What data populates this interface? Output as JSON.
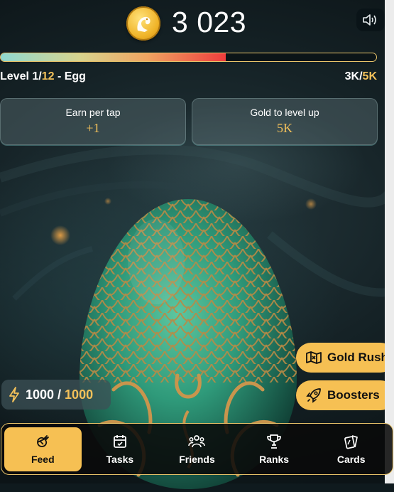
{
  "header": {
    "balance": "3 023",
    "coin_icon": "dragon-coin-icon",
    "sound_icon": "speaker-icon"
  },
  "progress": {
    "fraction": 0.6
  },
  "level": {
    "prefix": "Level 1/",
    "max": "12",
    "suffix": " - Egg",
    "current_gold": "3K/",
    "target_gold": "5K"
  },
  "stats": [
    {
      "label": "Earn per tap",
      "value": "+1"
    },
    {
      "label": "Gold to level up",
      "value": "5K"
    }
  ],
  "energy": {
    "current": "1000 / ",
    "max": "1000",
    "icon": "bolt-icon"
  },
  "actions": [
    {
      "label": "Gold Rush",
      "icon": "map-icon"
    },
    {
      "label": "Boosters",
      "icon": "rocket-icon"
    }
  ],
  "nav": [
    {
      "label": "Feed",
      "icon": "feed-icon",
      "active": true
    },
    {
      "label": "Tasks",
      "icon": "calendar-icon",
      "active": false
    },
    {
      "label": "Friends",
      "icon": "users-icon",
      "active": false
    },
    {
      "label": "Ranks",
      "icon": "trophy-icon",
      "active": false
    },
    {
      "label": "Cards",
      "icon": "cards-icon",
      "active": false
    }
  ],
  "colors": {
    "accent": "#f6c053",
    "gold_text": "#f3c15a",
    "egg": "#2f9a7a"
  }
}
